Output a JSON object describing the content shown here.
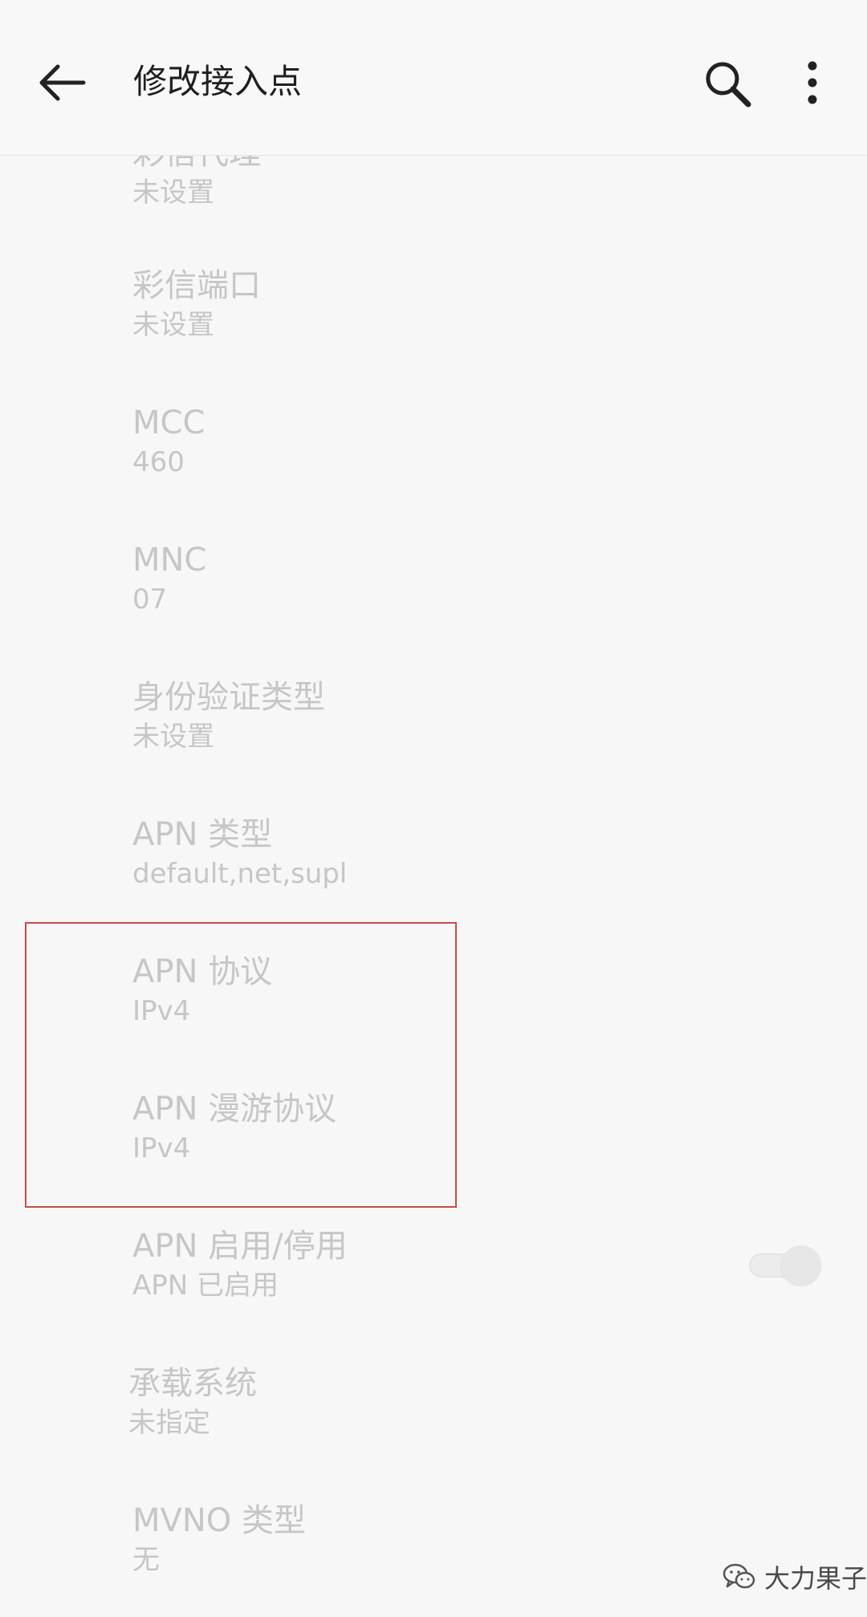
{
  "header": {
    "title": "修改接入点",
    "back_icon": "arrow-left-icon",
    "search_icon": "search-icon",
    "more_icon": "more-vert-icon",
    "title_color": "#1f1f1f"
  },
  "items": [
    {
      "title": "彩信代理",
      "summary": "未设置"
    },
    {
      "title": "彩信端口",
      "summary": "未设置"
    },
    {
      "title": "MCC",
      "summary": "460"
    },
    {
      "title": "MNC",
      "summary": "07"
    },
    {
      "title": "身份验证类型",
      "summary": "未设置"
    },
    {
      "title": "APN 类型",
      "summary": "default,net,supl"
    },
    {
      "title": "APN 协议",
      "summary": "IPv4"
    },
    {
      "title": "APN 漫游协议",
      "summary": "IPv4"
    },
    {
      "title": "APN 启用/停用",
      "summary": "APN 已启用",
      "toggle_on": true
    },
    {
      "title": "承载系统",
      "summary": "未指定"
    },
    {
      "title": "MVNO 类型",
      "summary": "无"
    }
  ],
  "highlight_color": "#c94b47",
  "watermark": {
    "text": "大力果子",
    "icon": "wechat-icon"
  }
}
